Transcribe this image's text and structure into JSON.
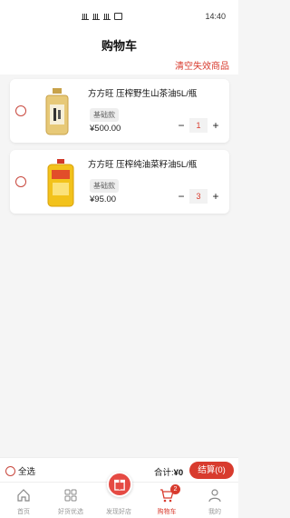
{
  "status_bar": {
    "time": "14:40"
  },
  "header": {
    "title": "购物车",
    "clear_invalid": "清空失效商品"
  },
  "items": [
    {
      "name": "方方旺 压榨野生山茶油5L/瓶",
      "variant": "基础款",
      "price": "¥500.00",
      "quantity": "1",
      "minus": "−",
      "plus": "+"
    },
    {
      "name": "方方旺 压榨纯油菜籽油5L/瓶",
      "variant": "基础款",
      "price": "¥95.00",
      "quantity": "3",
      "minus": "−",
      "plus": "+"
    }
  ],
  "checkout": {
    "select_all": "全选",
    "total_label": "合计:",
    "total_value": "¥0",
    "button": "结算(0)"
  },
  "tabbar": {
    "tabs": [
      {
        "label": "首页",
        "icon": "home-icon"
      },
      {
        "label": "好货优选",
        "icon": "grid-icon"
      },
      {
        "label": "发现好店",
        "icon": "gift-icon"
      },
      {
        "label": "购物车",
        "icon": "cart-icon",
        "badge": "2"
      },
      {
        "label": "我的",
        "icon": "user-icon"
      }
    ]
  },
  "colors": {
    "accent": "#d83b2e",
    "background": "#f5f5f5"
  }
}
